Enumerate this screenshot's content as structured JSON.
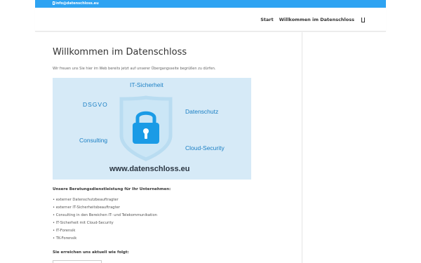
{
  "topbar": {
    "email": "info@datenschloss.eu",
    "email_icon": "mail-icon",
    "color": "#2ea3f2"
  },
  "nav": {
    "items": [
      {
        "label": "Start"
      },
      {
        "label": "Willkommen im Datenschloss"
      }
    ],
    "search_icon": "search-icon"
  },
  "main": {
    "title": "Willkommen im Datenschloss",
    "intro": "Wir freuen uns Sie hier im Web bereits jetzt auf unserer Übergangsseite begrüßen zu dürfen.",
    "banner": {
      "labels": {
        "it_sicherheit": "IT-Sicherheit",
        "dsgvo": "DSGVO",
        "datenschutz": "Datenschutz",
        "consulting": "Consulting",
        "cloud_security": "Cloud-Security"
      },
      "url": "www.datenschloss.eu",
      "icon": "lock-shield-icon",
      "background": "#d6eaf7",
      "accent": "#1a9be6"
    },
    "services_heading": "Unsere Beratungsdienstleistung für Ihr Unternehmen:",
    "services": [
      "externer Datenschutzbeauftragter",
      "externer IT-Sicherheitsbeauftragter",
      "Consulting in den Bereichen IT- und Telekommunikation",
      "IT-Sicherheit mit Cloud-Security",
      "IT-Forensik",
      "TK-Forensik"
    ],
    "contact_heading": "Sie erreichen uns aktuell wie folgt:"
  }
}
